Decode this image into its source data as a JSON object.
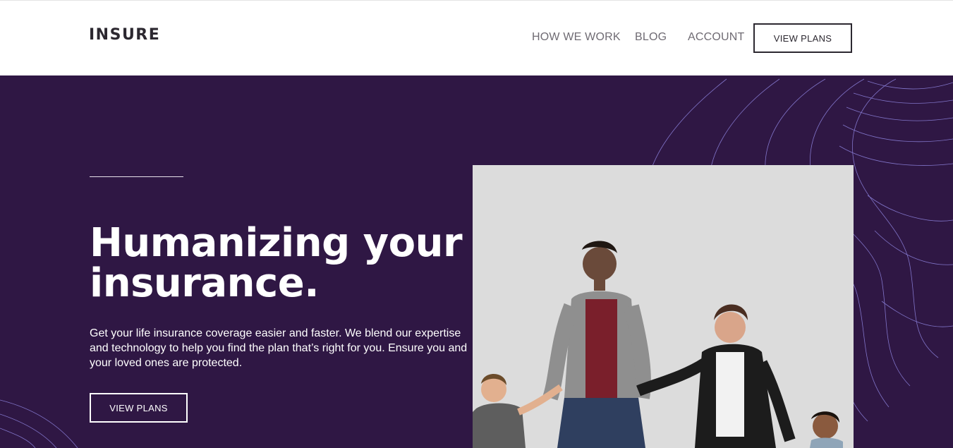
{
  "header": {
    "logo": "INSURE",
    "nav": {
      "how_we_work": "HOW WE WORK",
      "blog": "BLOG",
      "account": "ACCOUNT"
    },
    "cta": "VIEW PLANS"
  },
  "hero": {
    "title": "Humanizing your insurance.",
    "description": "Get your life insurance coverage easier and faster. We blend our expertise and technology to help you find the plan that’s right for you. Ensure you and your loved ones are protected.",
    "cta": "VIEW PLANS",
    "image_icon": "family-photo"
  },
  "colors": {
    "hero_bg": "#2f1744",
    "text_dark": "#2c2830",
    "nav_text": "#6f6b73",
    "wave_line": "#8a7fd8"
  }
}
